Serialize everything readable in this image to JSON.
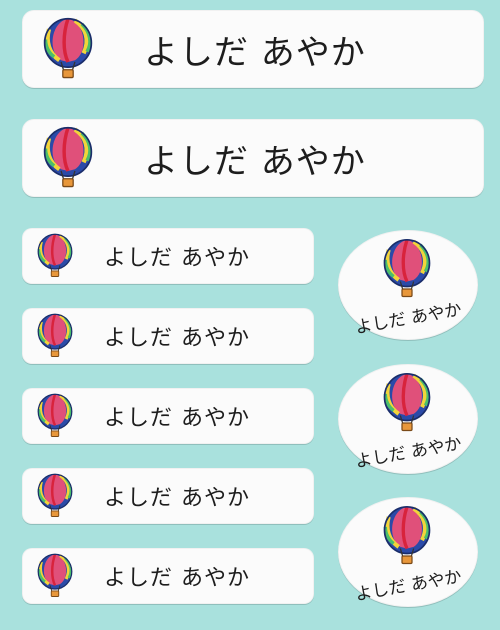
{
  "labels": {
    "name": "よしだ あやか"
  },
  "icon": "hot-air-balloon-icon",
  "colors": {
    "background": "#a9e1dd",
    "label": "#fbfbfb",
    "text": "#1d1d1d",
    "balloon_pink": "#e0507a",
    "balloon_blue": "#2b4aa8",
    "balloon_yellow": "#f2d43a",
    "balloon_green": "#4bbf6a",
    "balloon_red": "#d8233c",
    "basket": "#e8973a"
  }
}
